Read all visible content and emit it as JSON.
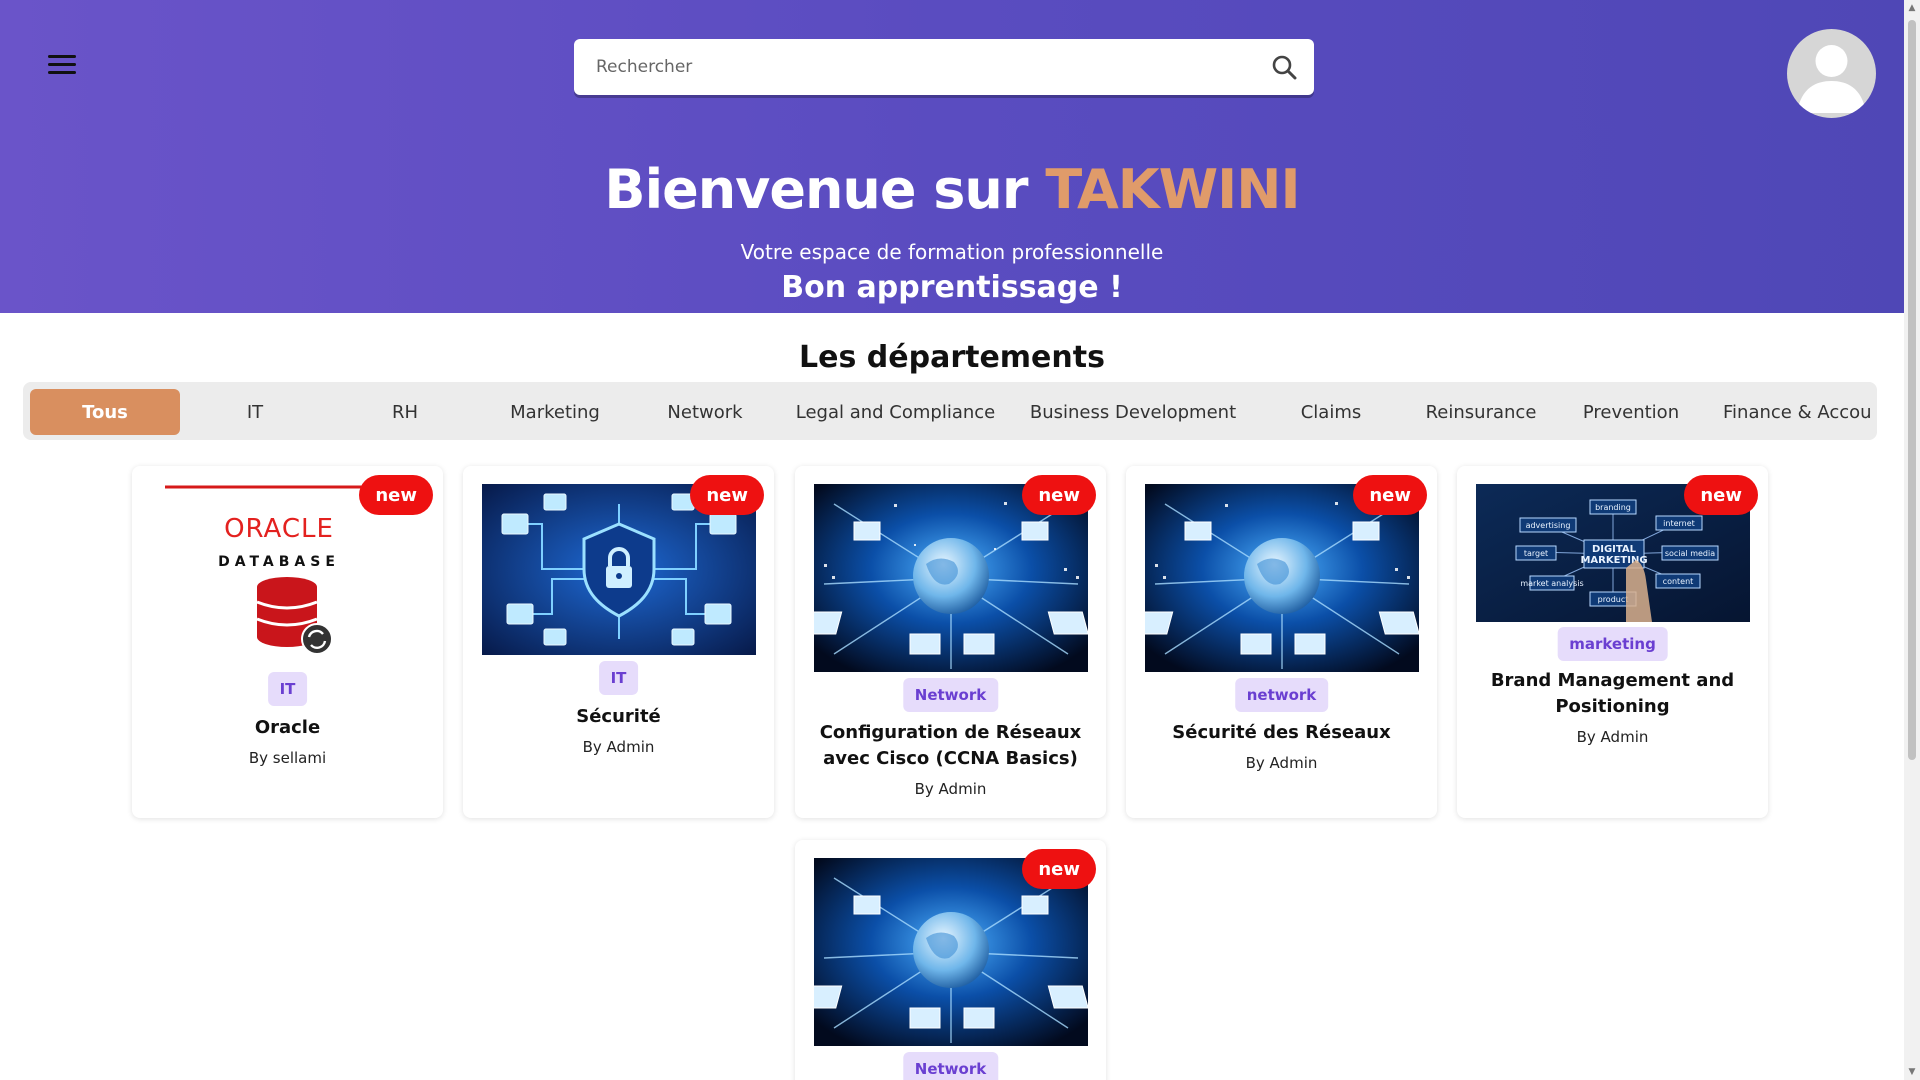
{
  "header": {
    "search_placeholder": "Rechercher",
    "title_prefix": "Bienvenue sur",
    "title_brand": "TAKWINI",
    "subtitle": "Votre espace de formation professionnelle",
    "tagline": "Bon apprentissage !"
  },
  "departments": {
    "title": "Les départements",
    "tabs": [
      "Tous",
      "IT",
      "RH",
      "Marketing",
      "Network",
      "Legal and Compliance",
      "Business Development",
      "Claims",
      "Reinsurance",
      "Prevention",
      "Finance & Accou"
    ],
    "active": "Tous"
  },
  "cards": [
    {
      "badge": "new",
      "tag": "IT",
      "title": "Oracle",
      "author": "By sellami",
      "image": "oracle-database-logo",
      "logo_text": "ORACLE",
      "logo_sub": "DATABASE"
    },
    {
      "badge": "new",
      "tag": "IT",
      "title": "Sécurité",
      "author": "By Admin",
      "image": "security-lock-illustration"
    },
    {
      "badge": "new",
      "tag": "Network",
      "title": "Configuration de Réseaux avec Cisco (CCNA Basics)",
      "author": "By Admin",
      "image": "network-globe-illustration"
    },
    {
      "badge": "new",
      "tag": "network",
      "title": "Sécurité des Réseaux",
      "author": "By Admin",
      "image": "network-globe-illustration"
    },
    {
      "badge": "new",
      "tag": "marketing",
      "title": "Brand Management and Positioning",
      "author": "By Admin",
      "image": "digital-marketing-illustration",
      "image_words": [
        "branding",
        "advertising",
        "internet",
        "target",
        "DIGITAL",
        "MARKETING",
        "social media",
        "market analysis",
        "content",
        "product"
      ]
    },
    {
      "badge": "new",
      "tag": "Network",
      "title": "",
      "author": "",
      "image": "network-globe-illustration"
    }
  ],
  "colors": {
    "hero_start": "#6a54c9",
    "hero_end": "#4f47b6",
    "brand": "#e09b6a",
    "active_tab": "#d98f5f",
    "badge_new": "#ee1111",
    "tag_bg": "#e6dcfb",
    "tag_text": "#6a3fd1"
  }
}
